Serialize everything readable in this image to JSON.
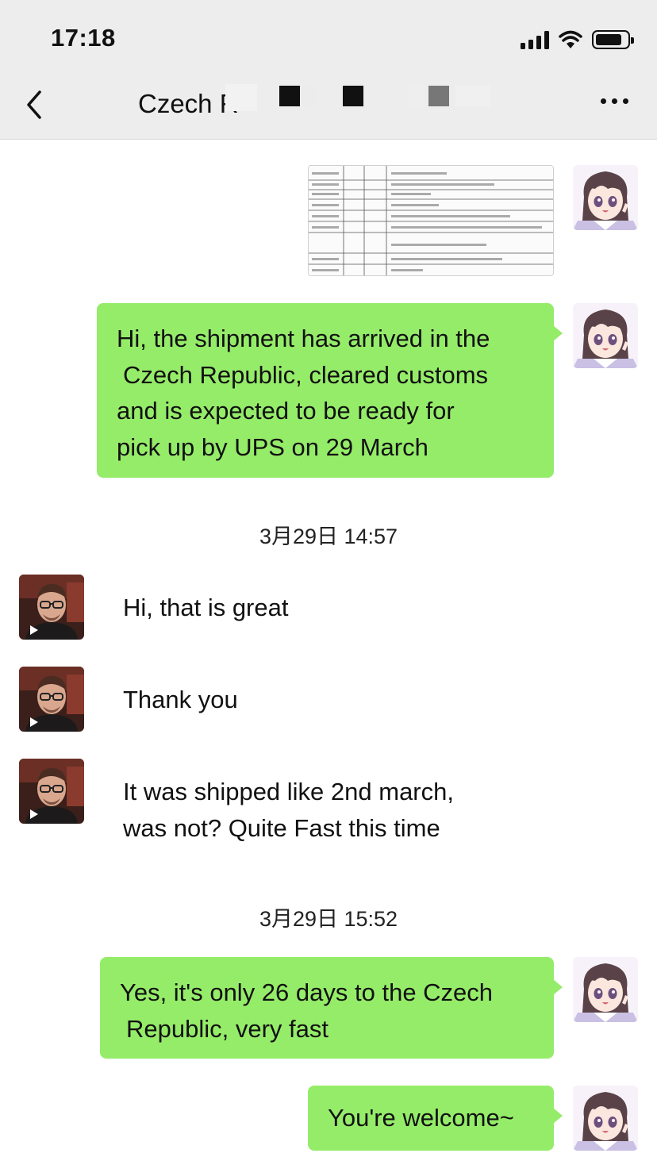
{
  "status_bar": {
    "time": "17:18"
  },
  "header": {
    "title": "Czech R"
  },
  "messages": {
    "m1": {
      "l1": "Hi, the shipment has arrived in the",
      "l2": "Czech Republic, cleared customs",
      "l3": "and is expected to be ready for",
      "l4": "pick up by UPS on 29 March"
    },
    "ts1": "3月29日 14:57",
    "m2": "Hi, that is great",
    "m3": "Thank you",
    "m4": {
      "l1": "It was shipped like 2nd march,",
      "l2": "was not? Quite Fast this time"
    },
    "ts2": "3月29日 15:52",
    "m5": {
      "l1": "Yes, it's only 26 days to the Czech",
      "l2": "Republic, very fast"
    },
    "m6": "You're welcome~"
  },
  "colors": {
    "bubble_out": "#95ec69",
    "nav_bg": "#ededed",
    "chat_bg": "#ffffff"
  }
}
